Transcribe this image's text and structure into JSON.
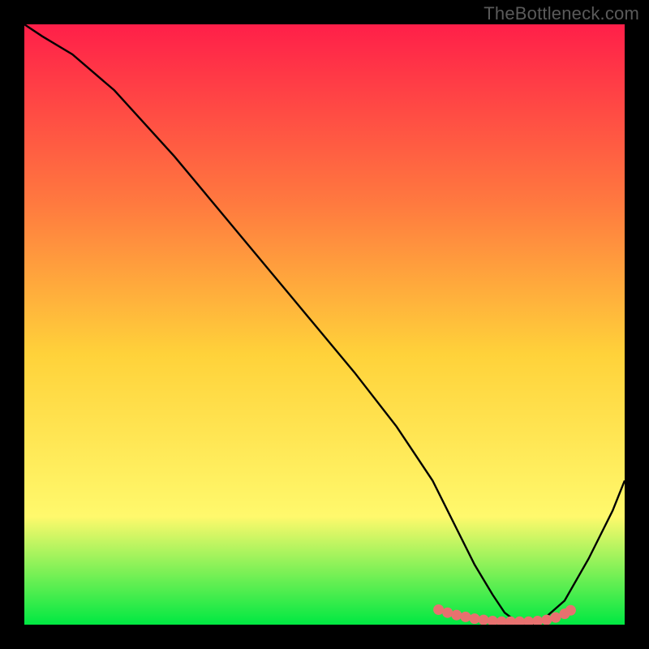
{
  "attribution": "TheBottleneck.com",
  "chart_data": {
    "type": "line",
    "title": "",
    "xlabel": "",
    "ylabel": "",
    "xlim": [
      0,
      100
    ],
    "ylim": [
      0,
      100
    ],
    "grid": false,
    "legend": false,
    "background_gradient": {
      "top": "#ff1f49",
      "mid_upper": "#ff7a3f",
      "mid": "#ffd23a",
      "mid_lower": "#fff96c",
      "bottom": "#00e842"
    },
    "series": [
      {
        "name": "bottleneck-curve",
        "stroke": "#000000",
        "x": [
          0,
          3,
          8,
          15,
          25,
          35,
          45,
          55,
          62,
          68,
          72,
          75,
          78,
          80,
          82,
          84,
          86,
          90,
          94,
          98,
          100
        ],
        "y": [
          100,
          98,
          95,
          89,
          78,
          66,
          54,
          42,
          33,
          24,
          16,
          10,
          5,
          2,
          0.5,
          0,
          0.5,
          4,
          11,
          19,
          24
        ]
      },
      {
        "name": "flat-bottom-markers",
        "type": "scatter",
        "stroke": "#e8716f",
        "x": [
          69,
          70.5,
          72,
          73.5,
          75,
          76.5,
          78,
          79.5,
          81,
          82.5,
          84,
          85.5,
          87,
          88.5,
          90,
          91
        ],
        "y": [
          2.5,
          2.0,
          1.6,
          1.3,
          1.0,
          0.8,
          0.6,
          0.5,
          0.5,
          0.5,
          0.5,
          0.6,
          0.8,
          1.2,
          1.8,
          2.4
        ]
      }
    ]
  }
}
